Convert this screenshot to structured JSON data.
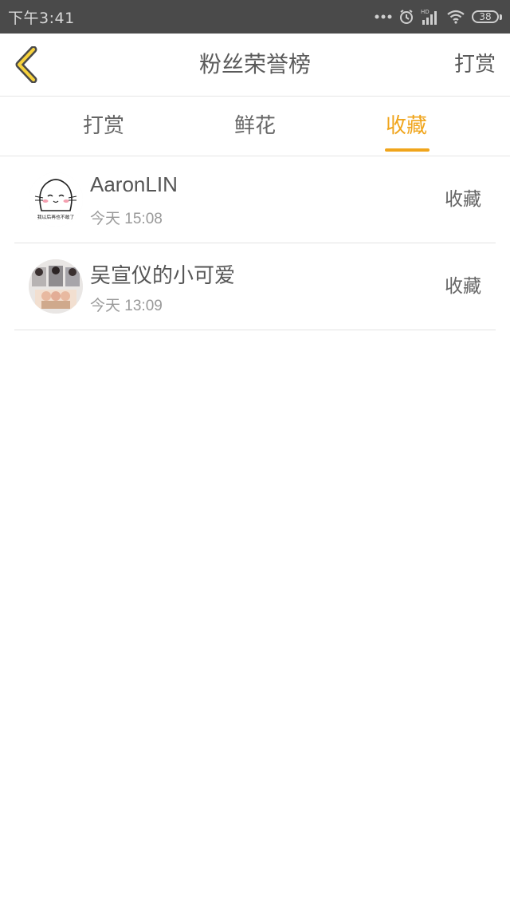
{
  "status_bar": {
    "time": "下午3:41",
    "battery": "38",
    "icons": [
      "more-dots-icon",
      "alarm-icon",
      "hd-signal-icon",
      "wifi-icon",
      "battery-icon"
    ]
  },
  "header": {
    "back_icon": "chevron-left-icon",
    "title": "粉丝荣誉榜",
    "action_label": "打赏"
  },
  "tabs": [
    {
      "label": "打赏",
      "active": false
    },
    {
      "label": "鲜花",
      "active": false
    },
    {
      "label": "收藏",
      "active": true
    }
  ],
  "list": [
    {
      "name": "AaronLIN",
      "time": "今天 15:08",
      "action": "收藏",
      "avatar_caption": "我以后再也不敢了"
    },
    {
      "name": "吴宣仪的小可爱",
      "time": "今天 13:09",
      "action": "收藏"
    }
  ],
  "colors": {
    "accent": "#f0a51c",
    "status_bar": "#4a4a4a",
    "divider": "#e6e6e6",
    "text_primary": "#555555",
    "text_secondary": "#9a9a9a"
  }
}
